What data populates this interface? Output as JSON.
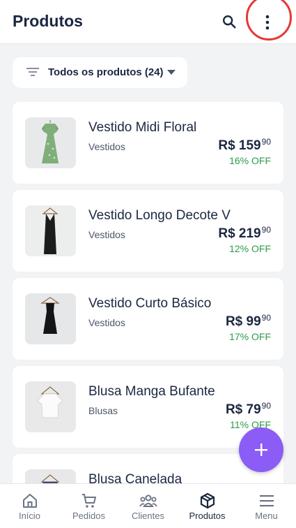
{
  "header": {
    "title": "Produtos"
  },
  "filter": {
    "label": "Todos os produtos (24)"
  },
  "products": [
    {
      "name": "Vestido Midi Floral",
      "category": "Vestidos",
      "price_int": "R$ 159",
      "price_cents": "90",
      "discount": "16% OFF"
    },
    {
      "name": "Vestido Longo Decote V",
      "category": "Vestidos",
      "price_int": "R$ 219",
      "price_cents": "90",
      "discount": "12% OFF"
    },
    {
      "name": "Vestido Curto Básico",
      "category": "Vestidos",
      "price_int": "R$ 99",
      "price_cents": "90",
      "discount": "17% OFF"
    },
    {
      "name": "Blusa Manga Bufante",
      "category": "Blusas",
      "price_int": "R$ 79",
      "price_cents": "90",
      "discount": "11% OFF"
    },
    {
      "name": "Blusa Canelada",
      "category": "",
      "price_int": "",
      "price_cents": "",
      "discount": ""
    }
  ],
  "nav": {
    "items": [
      {
        "label": "Início",
        "icon": "home-icon"
      },
      {
        "label": "Pedidos",
        "icon": "cart-icon"
      },
      {
        "label": "Clientes",
        "icon": "users-icon"
      },
      {
        "label": "Produtos",
        "icon": "box-icon",
        "active": true
      },
      {
        "label": "Menu",
        "icon": "menu-icon"
      }
    ]
  },
  "colors": {
    "accent": "#8b5cf6",
    "discount": "#2e9b4a",
    "highlight": "#e53935",
    "text": "#1b2740"
  }
}
